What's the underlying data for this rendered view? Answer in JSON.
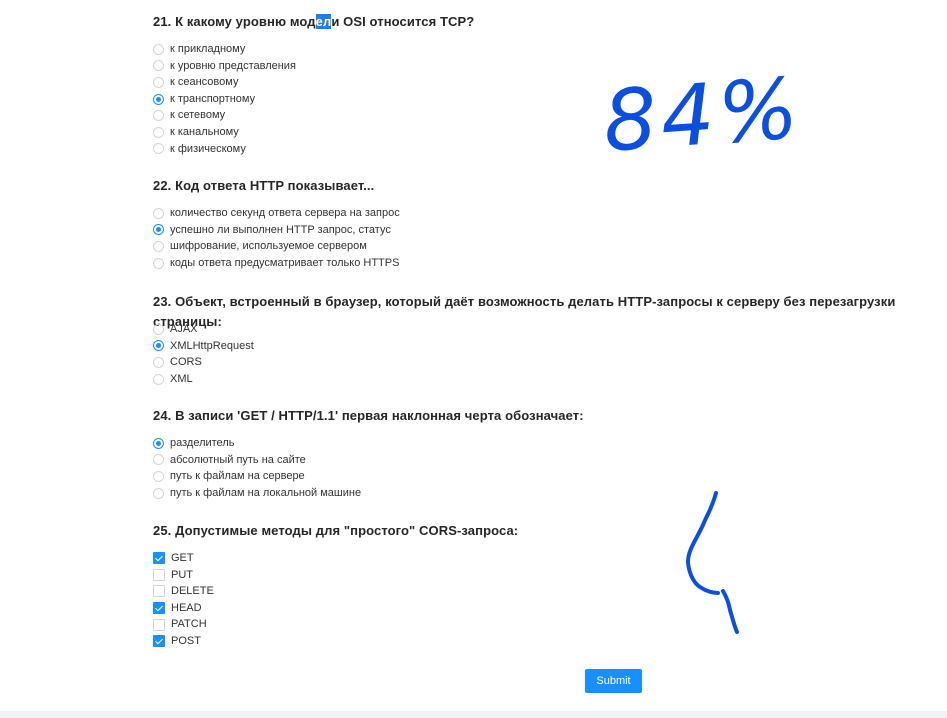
{
  "questions": [
    {
      "title_pre": "21. К какому уровню мод",
      "title_hl": "ел",
      "title_post": "и OSI относится TCP?",
      "type": "radio",
      "options": [
        {
          "label": "к прикладному",
          "checked": false
        },
        {
          "label": "к уровню представления",
          "checked": false
        },
        {
          "label": "к сеансовому",
          "checked": false
        },
        {
          "label": "к транспортному",
          "checked": true
        },
        {
          "label": "к сетевому",
          "checked": false
        },
        {
          "label": "к канальному",
          "checked": false
        },
        {
          "label": "к физическому",
          "checked": false
        }
      ]
    },
    {
      "title": "22. Код ответа HTTP показывает...",
      "type": "radio",
      "options": [
        {
          "label": "количество секунд ответа сервера на запрос",
          "checked": false
        },
        {
          "label": "успешно ли выполнен HTTP запрос, статус",
          "checked": true
        },
        {
          "label": "шифрование, используемое сервером",
          "checked": false
        },
        {
          "label": "коды ответа предусматривает только HTTPS",
          "checked": false
        }
      ]
    },
    {
      "title": "23. Объект, встроенный в браузер, который даёт возможность делать HTTP-запросы к серверу без перезагрузки страницы:",
      "type": "radio",
      "options": [
        {
          "label": "AJAX",
          "checked": false
        },
        {
          "label": "XMLHttpRequest",
          "checked": true
        },
        {
          "label": "CORS",
          "checked": false
        },
        {
          "label": "XML",
          "checked": false
        }
      ]
    },
    {
      "title": "24. В записи 'GET / HTTP/1.1' первая наклонная черта обозначает:",
      "type": "radio",
      "options": [
        {
          "label": "разделитель",
          "checked": true
        },
        {
          "label": "абсолютный путь на сайте",
          "checked": false
        },
        {
          "label": "путь к файлам на сервере",
          "checked": false
        },
        {
          "label": "путь к файлам на локальной машине",
          "checked": false
        }
      ]
    },
    {
      "title": "25. Допустимые методы для \"простого\" CORS-запроса:",
      "type": "checkbox",
      "options": [
        {
          "label": "GET",
          "checked": true
        },
        {
          "label": "PUT",
          "checked": false
        },
        {
          "label": "DELETE",
          "checked": false
        },
        {
          "label": "HEAD",
          "checked": true
        },
        {
          "label": "PATCH",
          "checked": false
        },
        {
          "label": "POST",
          "checked": true
        }
      ]
    }
  ],
  "submit_label": "Submit",
  "handwriting": {
    "score": "84%",
    "note": "4",
    "ink_color": "#0a4fe0"
  },
  "accent_color": "#1890ff"
}
